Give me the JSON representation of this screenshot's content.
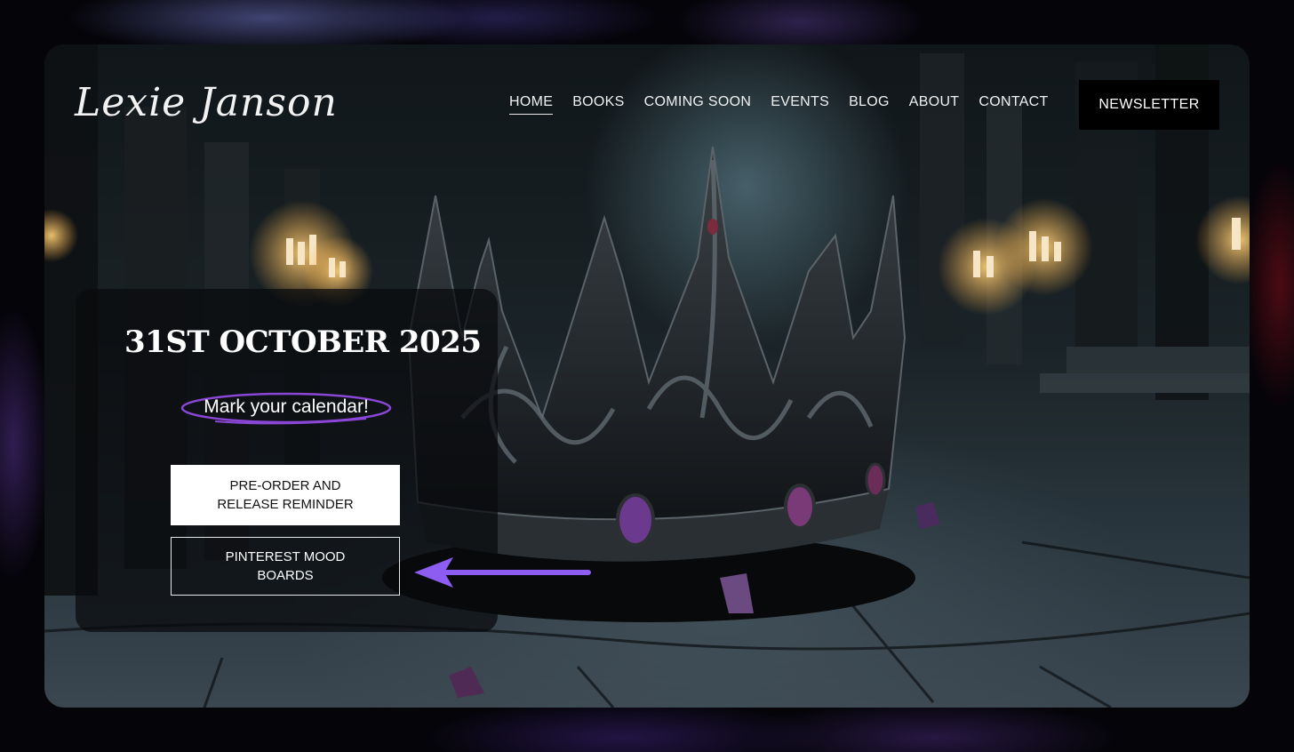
{
  "brand": {
    "logo_text": "Lexie Janson"
  },
  "nav": {
    "items": [
      {
        "label": "HOME",
        "active": true
      },
      {
        "label": "BOOKS"
      },
      {
        "label": "COMING SOON"
      },
      {
        "label": "EVENTS"
      },
      {
        "label": "BLOG"
      },
      {
        "label": "ABOUT"
      },
      {
        "label": "CONTACT"
      }
    ],
    "newsletter_label": "NEWSLETTER"
  },
  "hero": {
    "date": "31ST OCTOBER 2025",
    "tagline": "Mark your calendar!",
    "primary_button": "PRE-ORDER AND\nRELEASE REMINDER",
    "secondary_button": "PINTEREST MOOD\nBOARDS"
  },
  "colors": {
    "accent_purple": "#8a46d6",
    "arrow_purple": "#8d5cf0",
    "button_bg": "#ffffff"
  },
  "icons": [
    "purple-arrow-icon",
    "crown-illustration"
  ]
}
